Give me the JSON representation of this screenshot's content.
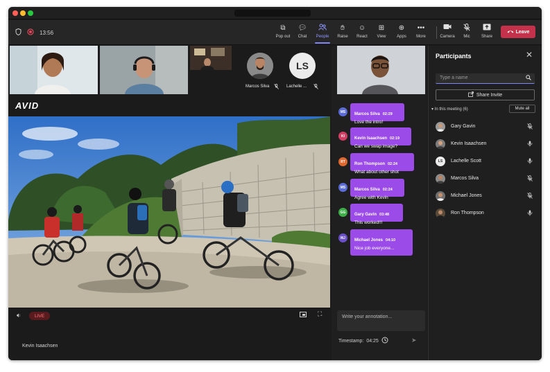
{
  "titlebar": {
    "dots": [
      "#ff5f57",
      "#febc2e",
      "#28c840"
    ]
  },
  "toolbar": {
    "timer": "13:56",
    "items": [
      {
        "label": "Pop out",
        "icon": "pop-out-icon"
      },
      {
        "label": "Chat",
        "icon": "chat-icon"
      },
      {
        "label": "People",
        "icon": "people-icon",
        "active": true
      },
      {
        "label": "Raise",
        "icon": "raise-hand-icon"
      },
      {
        "label": "React",
        "icon": "react-icon"
      },
      {
        "label": "View",
        "icon": "view-icon"
      },
      {
        "label": "Apps",
        "icon": "apps-icon"
      },
      {
        "label": "More",
        "icon": "more-icon"
      }
    ],
    "devices": [
      {
        "label": "Camera",
        "icon": "camera-icon"
      },
      {
        "label": "Mic",
        "icon": "mic-icon"
      },
      {
        "label": "Share",
        "icon": "share-icon"
      }
    ],
    "leave_label": "Leave"
  },
  "gallery": {
    "audio_participants": [
      {
        "name": "Marcos Silva",
        "muted": true
      },
      {
        "name": "Lachelle ...",
        "initials": "LS",
        "muted": true
      }
    ]
  },
  "stage": {
    "brand": "AVID",
    "live_label": "LIVE",
    "speaker_name": "Kevin Isaachsen"
  },
  "chat": {
    "messages": [
      {
        "initials": "MS",
        "name": "Marcos Silva",
        "time": "02:29",
        "text": "Love the intro!",
        "color": "#5b6cd9"
      },
      {
        "initials": "KI",
        "name": "Kevin Isaachsen",
        "time": "02:19",
        "text": "Can we swap image?",
        "color": "#d13e63"
      },
      {
        "initials": "RT",
        "name": "Ron Thompson",
        "time": "02:24",
        "text": "What about other shot",
        "color": "#e0682f"
      },
      {
        "initials": "MS",
        "name": "Marcos Silva",
        "time": "02:24",
        "text": "Agree with Kevin",
        "color": "#5b6cd9"
      },
      {
        "initials": "GG",
        "name": "Gary Gavin",
        "time": "03:48",
        "text": "This worked!!!",
        "color": "#3fae49"
      },
      {
        "initials": "MJ",
        "name": "Michael Jones",
        "time": "04:10",
        "text": "Nice job everyone...",
        "color": "#6a4fc9"
      }
    ],
    "annotation_placeholder": "Write your annotation...",
    "timestamp_label": "Timestamp:",
    "timestamp_value": "04:25"
  },
  "participants_panel": {
    "title": "Participants",
    "search_placeholder": "Type a name",
    "share_invite_label": "Share Invite",
    "in_meeting_label": "In this meeting (6)",
    "mute_all_label": "Mute all",
    "people": [
      {
        "name": "Gary Gavin",
        "mic": "muted"
      },
      {
        "name": "Kevin Isaachsen",
        "mic": "on"
      },
      {
        "name": "Lachelle Scott",
        "initials": "LS",
        "mic": "on"
      },
      {
        "name": "Marcos Silva",
        "mic": "muted"
      },
      {
        "name": "Michael Jones",
        "mic": "muted"
      },
      {
        "name": "Ron Thompson",
        "mic": "on"
      }
    ]
  }
}
